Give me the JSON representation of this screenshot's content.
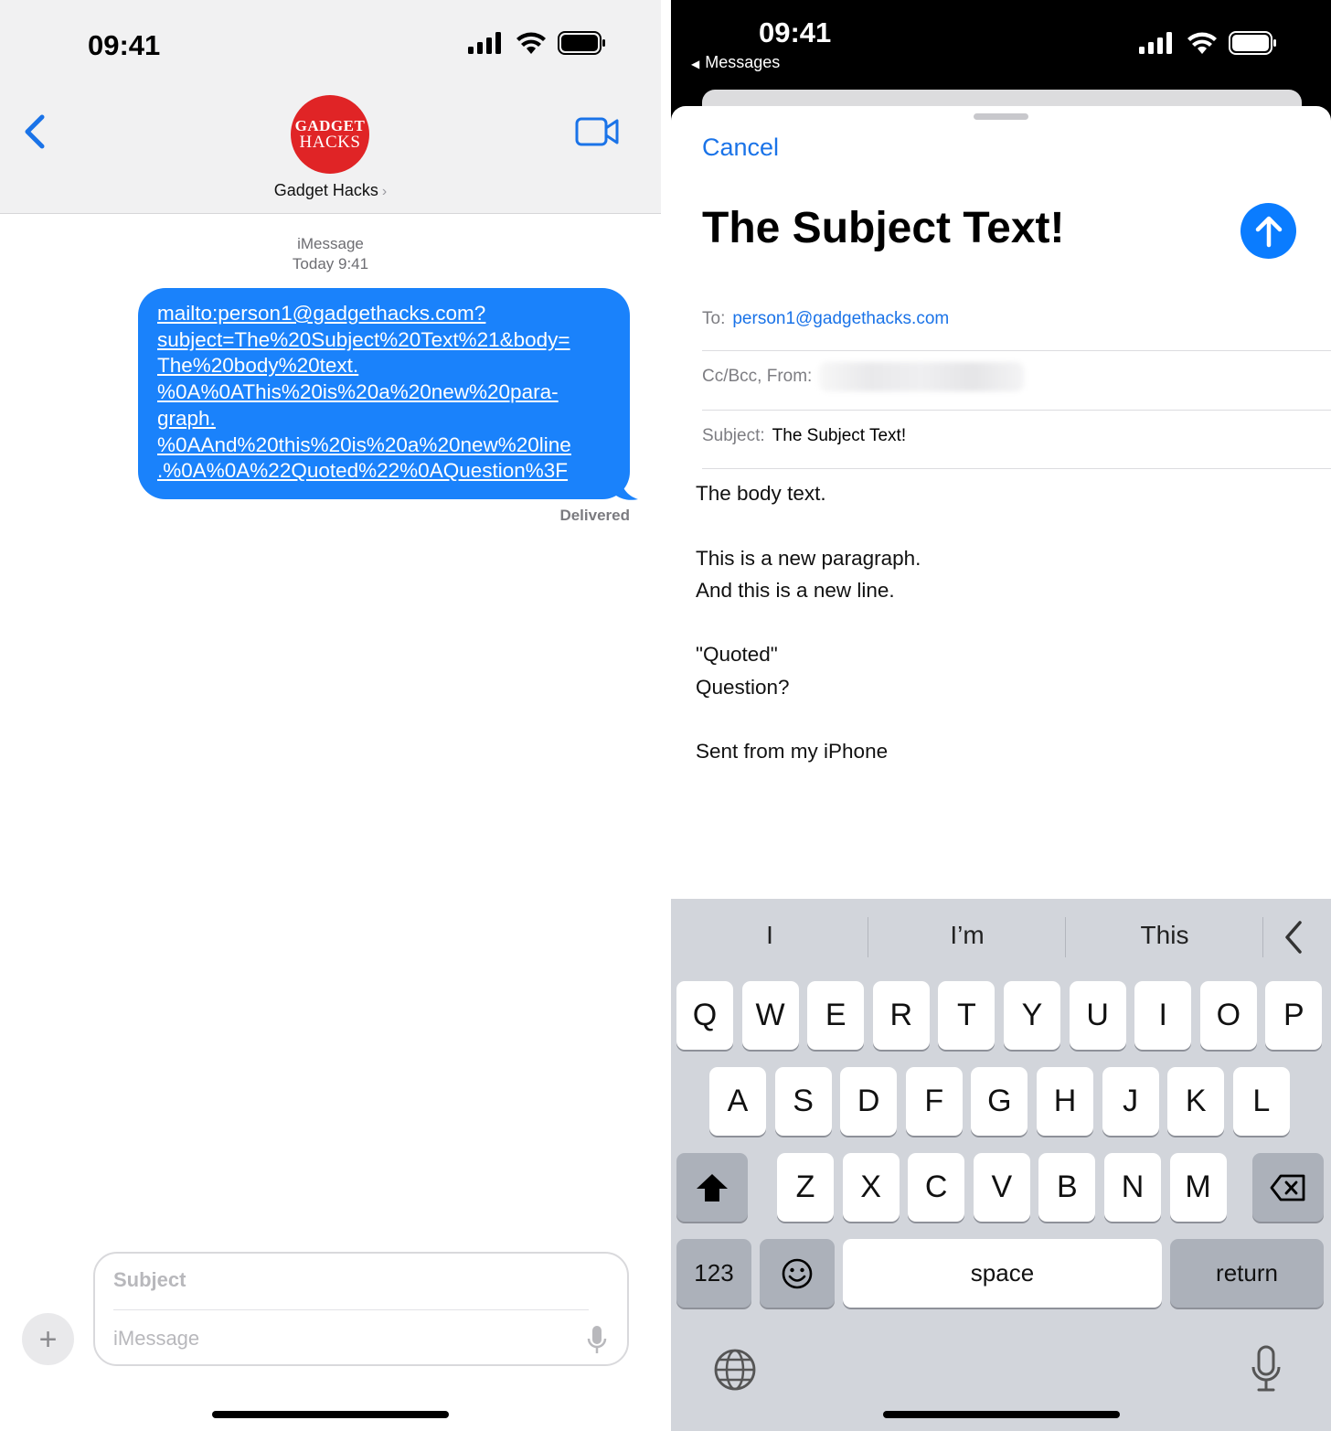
{
  "left": {
    "status_bar": {
      "time": "09:41"
    },
    "contact": {
      "avatar_line1": "GADGET",
      "avatar_line2": "HACKS",
      "name": "Gadget Hacks",
      "chevron": "›"
    },
    "thread": {
      "service": "iMessage",
      "timestamp": "Today 9:41",
      "message_lines": [
        "mailto:person1@gadgethacks.com?",
        "subject=The%20Subject%20Text%21&body=",
        "The%20body%20text.",
        "%0A%0AThis%20is%20a%20new%20para-",
        "graph.",
        "%0AAnd%20this%20is%20a%20new%20line",
        ".%0A%0A%22Quoted%22%0AQuestion%3F"
      ],
      "status": "Delivered"
    },
    "composer": {
      "plus": "+",
      "subject_placeholder": "Subject",
      "message_placeholder": "iMessage"
    }
  },
  "right": {
    "status_bar": {
      "time": "09:41",
      "back_app": "Messages",
      "back_arrow": "◀"
    },
    "mail": {
      "cancel": "Cancel",
      "title": "The Subject Text!",
      "to_label": "To:",
      "to_value": "person1@gadgethacks.com",
      "ccbcc_label": "Cc/Bcc, From:",
      "subject_label": "Subject:",
      "subject_value": "The Subject Text!",
      "body": "The body text.\n\nThis is a new paragraph.\nAnd this is a new line.\n\n\"Quoted\"\nQuestion?\n\nSent from my iPhone"
    },
    "keyboard": {
      "suggestions": [
        "I",
        "I’m",
        "This"
      ],
      "row1": [
        "Q",
        "W",
        "E",
        "R",
        "T",
        "Y",
        "U",
        "I",
        "O",
        "P"
      ],
      "row2": [
        "A",
        "S",
        "D",
        "F",
        "G",
        "H",
        "J",
        "K",
        "L"
      ],
      "row3": [
        "Z",
        "X",
        "C",
        "V",
        "B",
        "N",
        "M"
      ],
      "numbers_key": "123",
      "space_key": "space",
      "return_key": "return"
    }
  },
  "colors": {
    "imessage_blue": "#1a82fb",
    "link_blue": "#1a73e8",
    "send_blue": "#0a7cff",
    "keyboard_bg": "#d2d5db",
    "brand_red": "#e02426"
  },
  "icons": [
    "cellular-signal-icon",
    "wifi-icon",
    "battery-icon",
    "back-chevron-icon",
    "facetime-video-icon",
    "microphone-icon",
    "send-arrow-up-icon",
    "shift-icon",
    "delete-backspace-icon",
    "emoji-icon",
    "globe-icon",
    "keyboard-collapse-chevron-icon"
  ]
}
